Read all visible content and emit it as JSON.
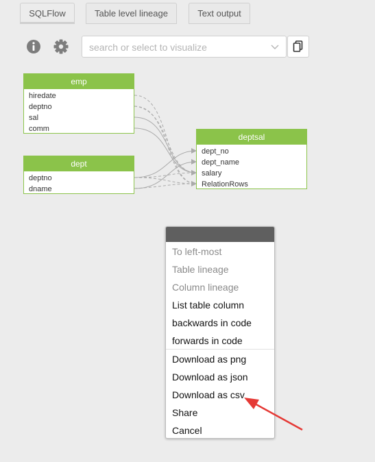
{
  "tabs": [
    {
      "label": "SQLFlow",
      "active": true
    },
    {
      "label": "Table level lineage",
      "active": false
    },
    {
      "label": "Text output",
      "active": false
    }
  ],
  "toolbar": {
    "info_icon": "info-icon",
    "settings_icon": "gear-icon",
    "search_placeholder": "search or select to visualize",
    "search_value": "",
    "dropdown_icon": "chevron-down-icon",
    "copy_icon": "copy-icon"
  },
  "tables": {
    "emp": {
      "name": "emp",
      "columns": [
        "hiredate",
        "deptno",
        "sal",
        "comm"
      ]
    },
    "dept": {
      "name": "dept",
      "columns": [
        "deptno",
        "dname"
      ]
    },
    "deptsal": {
      "name": "deptsal",
      "columns": [
        "dept_no",
        "dept_name",
        "salary",
        "RelationRows"
      ]
    }
  },
  "context_menu": {
    "items": [
      {
        "label": "To left-most",
        "enabled": false
      },
      {
        "label": "Table lineage",
        "enabled": false
      },
      {
        "label": "Column lineage",
        "enabled": false
      },
      {
        "label": "List table column",
        "enabled": true
      },
      {
        "label": "backwards in code",
        "enabled": true
      },
      {
        "label": "forwards in code",
        "enabled": true
      },
      {
        "label": "Download as png",
        "enabled": true
      },
      {
        "label": "Download as json",
        "enabled": true
      },
      {
        "label": "Download as csv",
        "enabled": true
      },
      {
        "label": "Share",
        "enabled": true
      },
      {
        "label": "Cancel",
        "enabled": true
      }
    ]
  },
  "colors": {
    "table_header": "#8bc34a",
    "menu_header": "#5f5f5f",
    "lineage_line": "#aaaaaa",
    "annotation_arrow": "#e53935"
  }
}
